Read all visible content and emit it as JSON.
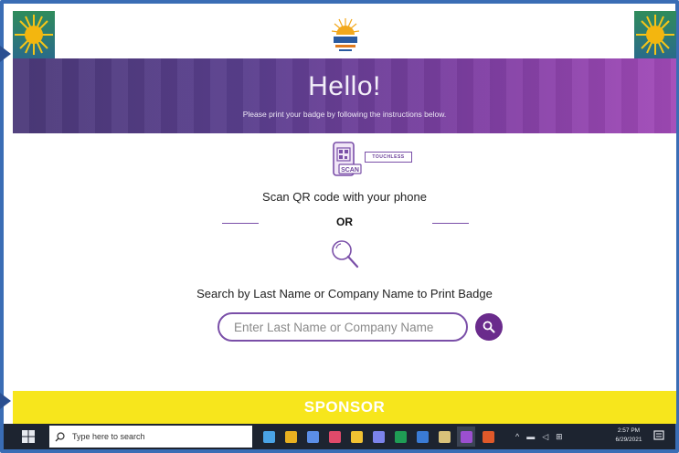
{
  "header": {
    "logo_icon": "event-sun-logo-icon",
    "corner_icon": "sunburst-icon"
  },
  "hero": {
    "title": "Hello!",
    "subtitle": "Please print your badge by following the instructions below."
  },
  "scan": {
    "icon": "phone-qr-scan-icon",
    "badge": "TOUCHLESS",
    "phone_label": "SCAN",
    "instruction": "Scan QR code with your phone"
  },
  "divider": {
    "label": "OR"
  },
  "search": {
    "icon": "magnifier-icon",
    "label": "Search by Last Name or Company Name to Print Badge",
    "placeholder": "Enter Last Name or Company Name",
    "value": "",
    "button_icon": "search-icon"
  },
  "sponsor": {
    "label": "SPONSOR"
  },
  "taskbar": {
    "search_placeholder": "Type here to search",
    "apps": [
      {
        "name": "task-view-icon",
        "color": "#4aa3e6"
      },
      {
        "name": "chrome-icon",
        "color": "#e8b020"
      },
      {
        "name": "people-icon",
        "color": "#5b8ee6"
      },
      {
        "name": "paint-icon",
        "color": "#e04a6a"
      },
      {
        "name": "file-explorer-icon",
        "color": "#f1c232"
      },
      {
        "name": "teams-icon",
        "color": "#7b83eb"
      },
      {
        "name": "excel-icon",
        "color": "#1f9d55"
      },
      {
        "name": "powershell-icon",
        "color": "#3a7bd5"
      },
      {
        "name": "image-app-icon",
        "color": "#d9c27a"
      },
      {
        "name": "onenote-icon",
        "color": "#9b4fd0"
      },
      {
        "name": "powerpoint-icon",
        "color": "#e0592a"
      }
    ],
    "clock_time": "2:57 PM",
    "clock_date": "6/29/2021"
  },
  "colors": {
    "accent_purple": "#7a4fa8",
    "button_purple": "#6a2b8c",
    "sponsor_yellow": "#f7e61c",
    "frame_blue": "#3a6db5"
  }
}
